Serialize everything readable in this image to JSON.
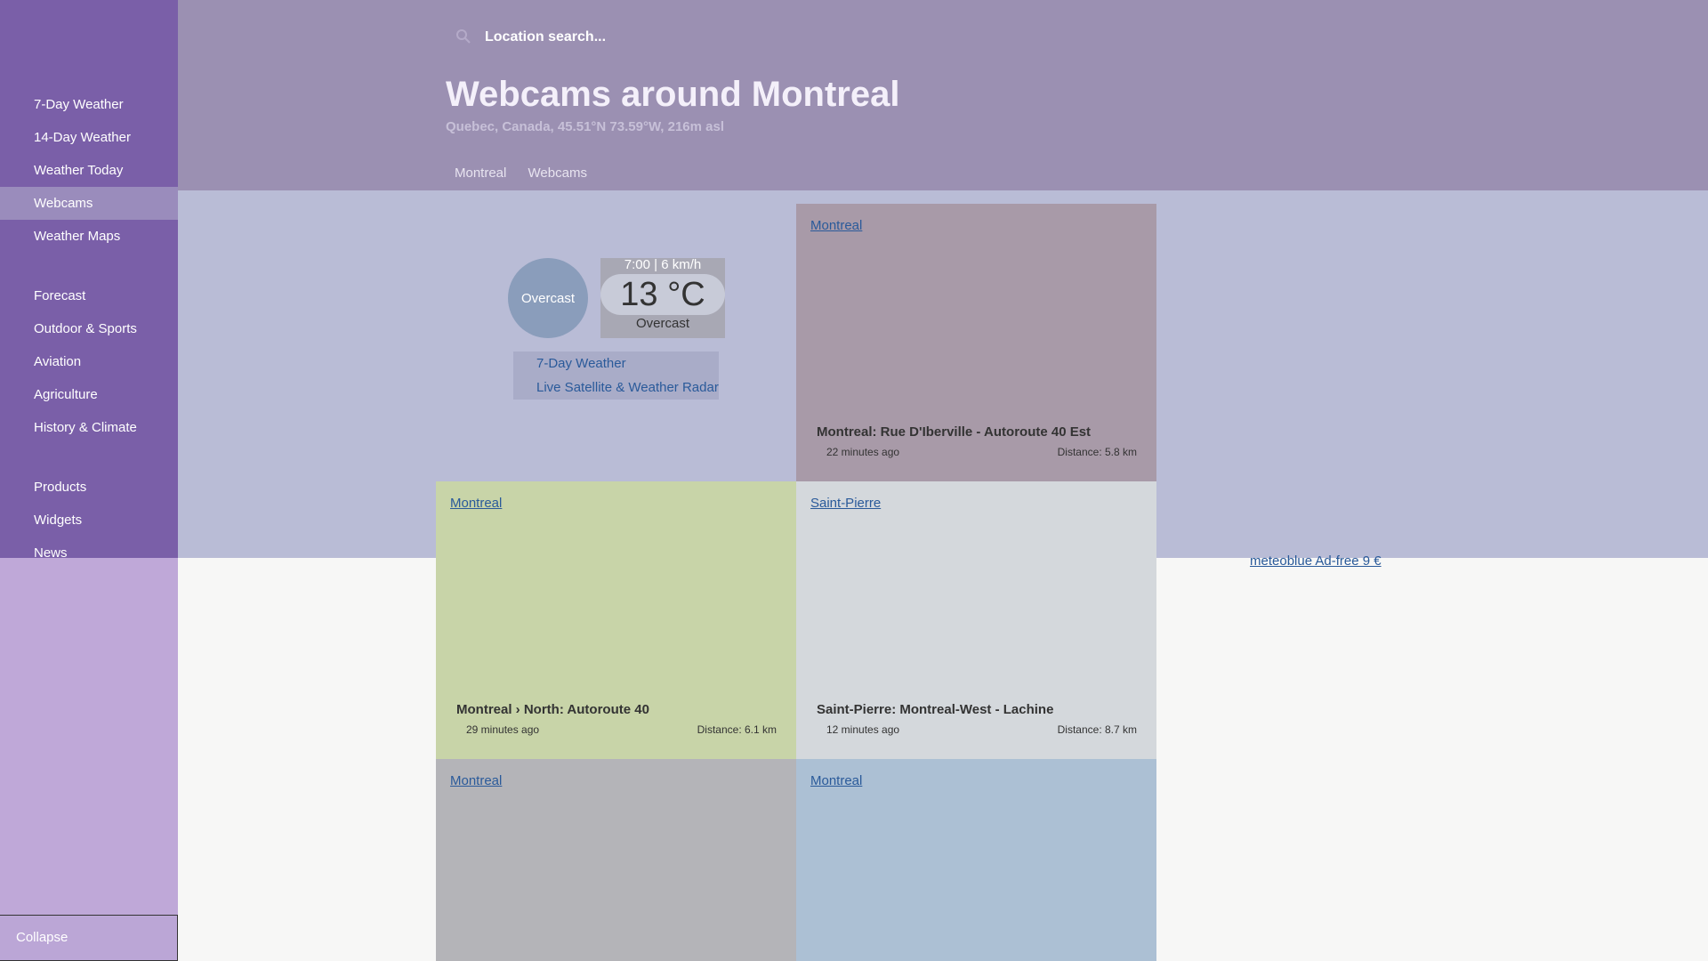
{
  "nav": {
    "items": [
      {
        "label": "7-Day Weather"
      },
      {
        "label": "14-Day Weather"
      },
      {
        "label": "Weather Today"
      },
      {
        "label": "Webcams"
      },
      {
        "label": "Weather Maps"
      },
      {
        "label": "Forecast"
      },
      {
        "label": "Outdoor & Sports"
      },
      {
        "label": "Aviation"
      },
      {
        "label": "Agriculture"
      },
      {
        "label": "History & Climate"
      },
      {
        "label": "Products"
      },
      {
        "label": "Widgets"
      },
      {
        "label": "News"
      }
    ],
    "active": "Webcams",
    "collapse_label": "Collapse",
    "collapse_icon": "",
    "home_icon": ""
  },
  "search": {
    "placeholder": "Location search..."
  },
  "header": {
    "title": "Webcams around Montreal",
    "subtitle": "Quebec, Canada, 45.51°N 73.59°W, 216m asl"
  },
  "breadcrumb": {
    "home_icon": "",
    "separator": "",
    "items": [
      "Montreal",
      "Webcams"
    ]
  },
  "current_weather": {
    "icon_alt": "Overcast",
    "time_wind": "7:00 | 6 km/h",
    "temperature": "13 °C",
    "condition": "Overcast",
    "links": [
      "7-Day Weather",
      "Live Satellite & Weather Radar"
    ]
  },
  "webcams": [
    {
      "image_alt": "Montreal",
      "title": "Montreal: Rue D'Iberville - Autoroute 40 Est",
      "ago": "22 minutes ago",
      "distance": "Distance: 5.8 km",
      "card_color": "#a89aa8",
      "cell_color": "#a89aa8"
    },
    {
      "image_alt": "Montreal",
      "title": "Montreal › North: Autoroute 40",
      "ago": "29 minutes ago",
      "distance": "Distance: 6.1 km",
      "card_color": "#c8d4a8",
      "cell_color": "#c8d4a8"
    },
    {
      "image_alt": "Saint-Pierre",
      "title": "Saint-Pierre: Montreal-West - Lachine",
      "ago": "12 minutes ago",
      "distance": "Distance: 8.7 km",
      "card_color": "#d4d8dc",
      "cell_color": "#d4d8dc"
    },
    {
      "image_alt": "Montreal",
      "title": "",
      "ago": "",
      "distance": "",
      "card_color": "#b4b4b8",
      "cell_color": "#b4b4b8"
    },
    {
      "image_alt": "Montreal",
      "title": "",
      "ago": "",
      "distance": "",
      "card_color": "#acc0d4",
      "cell_color": "#acc0d4"
    }
  ],
  "ad": {
    "label": "meteoblue Ad-free 9 €"
  }
}
